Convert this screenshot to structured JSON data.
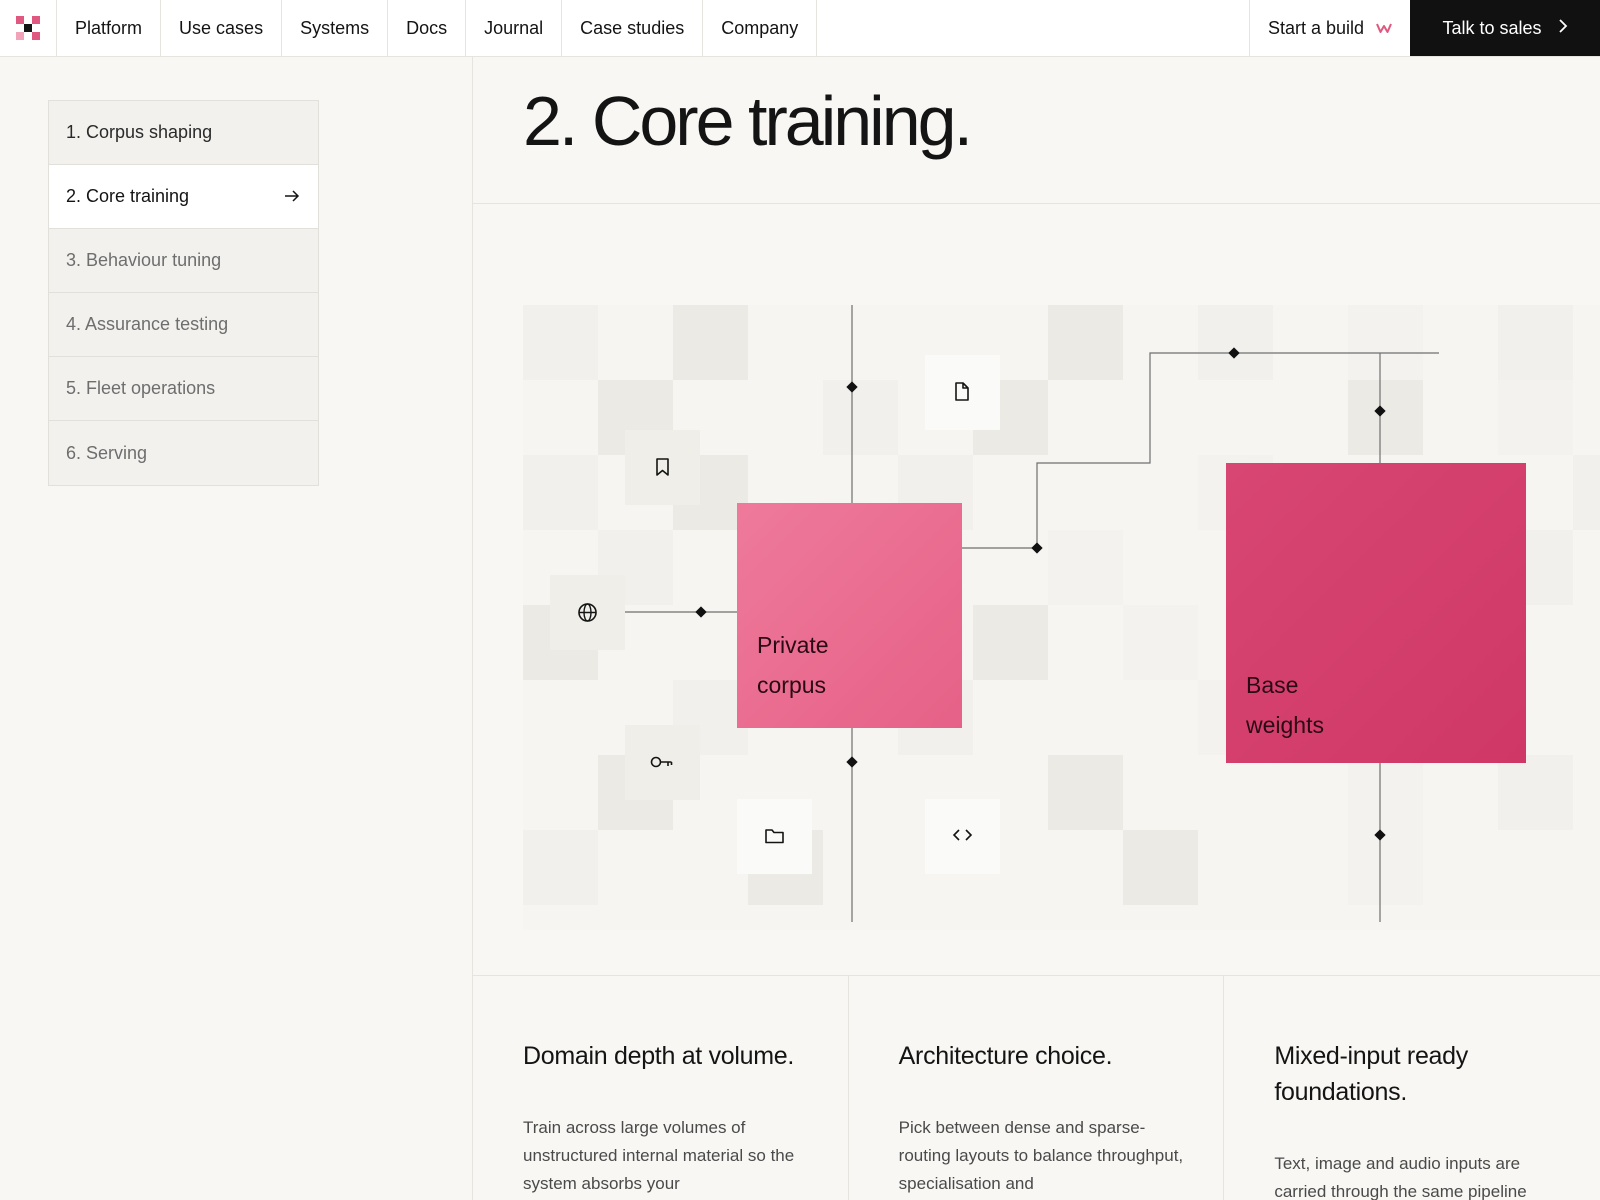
{
  "brand": {
    "logo_icon": "pixel-logo-icon",
    "accent": "#e0577f",
    "accent_dark": "#d43a6a"
  },
  "nav": {
    "items": [
      "Platform",
      "Use cases",
      "Systems",
      "Docs",
      "Journal",
      "Case studies",
      "Company"
    ],
    "start_build": "Start a build",
    "start_build_icon": "w-mark-icon",
    "talk_sales": "Talk to sales",
    "talk_sales_icon": "chevron-right-icon"
  },
  "steps": [
    {
      "label": "1. Corpus shaping",
      "state": "done"
    },
    {
      "label": "2. Core training",
      "state": "active",
      "icon": "arrow-right-icon"
    },
    {
      "label": "3. Behaviour tuning",
      "state": "upcoming"
    },
    {
      "label": "4. Assurance testing",
      "state": "upcoming"
    },
    {
      "label": "5. Fleet operations",
      "state": "upcoming"
    },
    {
      "label": "6. Serving",
      "state": "upcoming"
    }
  ],
  "page": {
    "title": "2. Core training."
  },
  "diagram": {
    "tiles": [
      {
        "line1": "Private",
        "line2": "corpus",
        "color": "#eb6f92"
      },
      {
        "line1": "Base",
        "line2": "weights",
        "color": "#d6406f"
      }
    ],
    "icons": [
      "document-icon",
      "bookmark-icon",
      "globe-icon",
      "key-icon",
      "folder-icon",
      "code-icon"
    ]
  },
  "features": [
    {
      "title": "Domain depth at volume.",
      "text": "Train across large volumes of unstructured internal material so the system absorbs your"
    },
    {
      "title": "Architecture choice.",
      "text": "Pick between dense and sparse-routing layouts to balance throughput, specialisation and"
    },
    {
      "title": "Mixed-input ready foundations.",
      "text": "Text, image and audio inputs are carried through the same pipeline"
    }
  ]
}
